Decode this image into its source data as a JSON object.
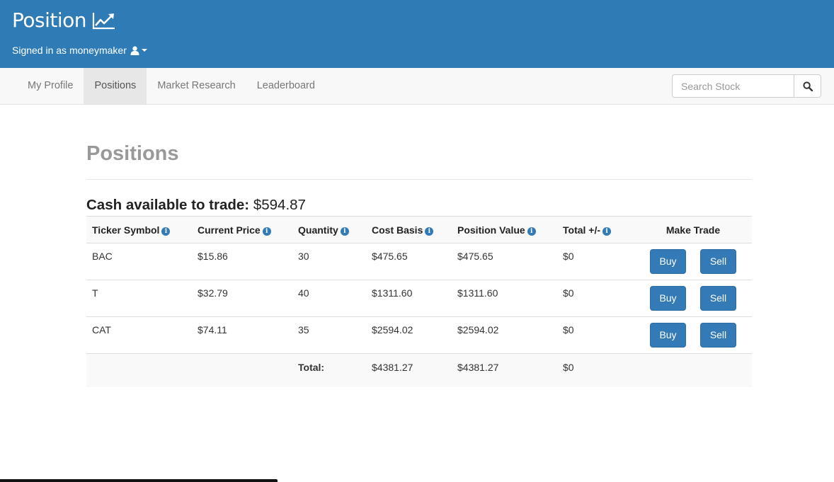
{
  "header": {
    "brand": "Position",
    "brand_icon": "chart-line-icon",
    "signed_in_text": "Signed in as moneymaker",
    "user_icon": "user-icon",
    "caret_icon": "caret-down-icon"
  },
  "nav": {
    "items": [
      {
        "label": "My Profile",
        "active": false
      },
      {
        "label": "Positions",
        "active": true
      },
      {
        "label": "Market Research",
        "active": false
      },
      {
        "label": "Leaderboard",
        "active": false
      }
    ],
    "search": {
      "placeholder": "Search Stock",
      "icon": "search-icon"
    }
  },
  "main": {
    "title": "Positions",
    "cash_label": "Cash available to trade:",
    "cash_value": "$594.87",
    "table": {
      "headers": [
        "Ticker Symbol",
        "Current Price",
        "Quantity",
        "Cost Basis",
        "Position Value",
        "Total +/-",
        "Make Trade"
      ],
      "rows": [
        {
          "ticker": "BAC",
          "price": "$15.86",
          "quantity": "30",
          "cost_basis": "$475.65",
          "position_value": "$475.65",
          "total": "$0"
        },
        {
          "ticker": "T",
          "price": "$32.79",
          "quantity": "40",
          "cost_basis": "$1311.60",
          "position_value": "$1311.60",
          "total": "$0"
        },
        {
          "ticker": "CAT",
          "price": "$74.11",
          "quantity": "35",
          "cost_basis": "$2594.02",
          "position_value": "$2594.02",
          "total": "$0"
        }
      ],
      "buy_label": "Buy",
      "sell_label": "Sell",
      "totals": {
        "label": "Total:",
        "cost_basis": "$4381.27",
        "position_value": "$4381.27",
        "total": "$0"
      }
    }
  },
  "colors": {
    "header_bg": "#2e7bb6",
    "button_bg": "#337ab7",
    "info_icon": "#337ab7"
  }
}
